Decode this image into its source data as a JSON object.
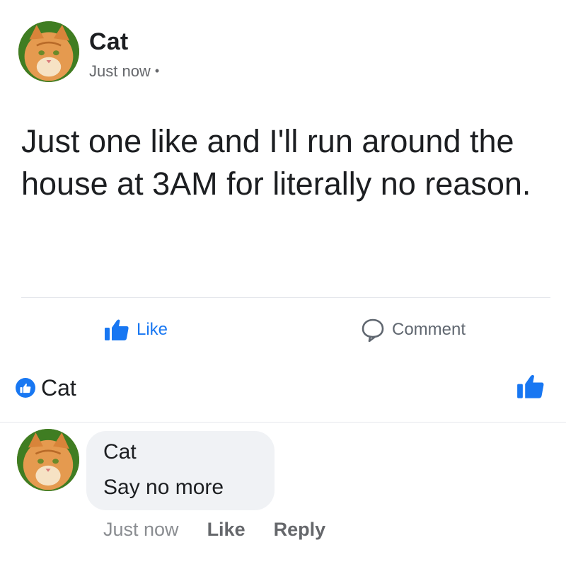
{
  "post": {
    "author": "Cat",
    "timestamp": "Just now",
    "separator": "•",
    "text": "Just one like and I'll run around the house at 3AM for literally no reason."
  },
  "actions": {
    "like_label": "Like",
    "comment_label": "Comment"
  },
  "reactions": {
    "reactor_name": "Cat"
  },
  "comment": {
    "author": "Cat",
    "text": "Say no more",
    "timestamp": "Just now",
    "like_label": "Like",
    "reply_label": "Reply"
  },
  "colors": {
    "accent": "#1877f2",
    "muted_text": "#65676b",
    "bubble": "#f0f2f5"
  },
  "icons": {
    "like": "thumbs-up-icon",
    "comment": "speech-bubble-icon",
    "reaction_badge": "thumbs-up-badge-icon"
  }
}
